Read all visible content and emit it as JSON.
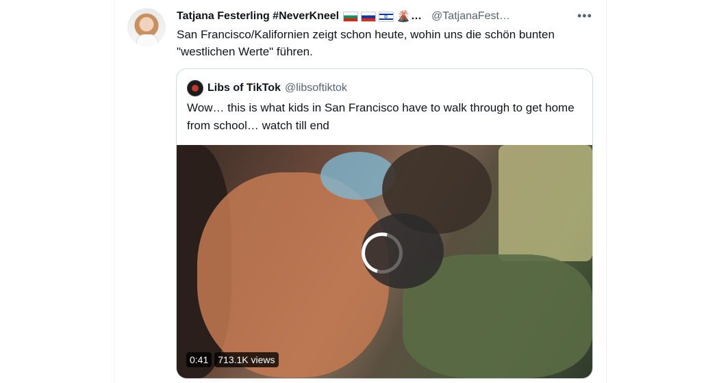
{
  "tweet": {
    "author_name": "Tatjana Festerling #NeverKneel",
    "name_ellipsis": "…",
    "flag_icons": [
      "bulgaria-flag-icon",
      "russia-flag-icon",
      "israel-flag-icon",
      "volcano-icon"
    ],
    "handle": "@TatjanaFest…",
    "more_icon": "more-options-icon",
    "text": "San Francisco/Kalifornien zeigt schon heute, wohin uns die schön bunten \"westlichen Werte\" führen."
  },
  "quoted": {
    "author_name": "Libs of TikTok",
    "handle": "@libsoftiktok",
    "text": "Wow… this is what kids in San Francisco have to walk through to get home from school… watch till end",
    "video": {
      "duration": "0:41",
      "views": "713.1K views",
      "state": "loading-spinner"
    }
  },
  "colors": {
    "text": "#0f1419",
    "secondary": "#536471",
    "border": "#cfd9de"
  }
}
